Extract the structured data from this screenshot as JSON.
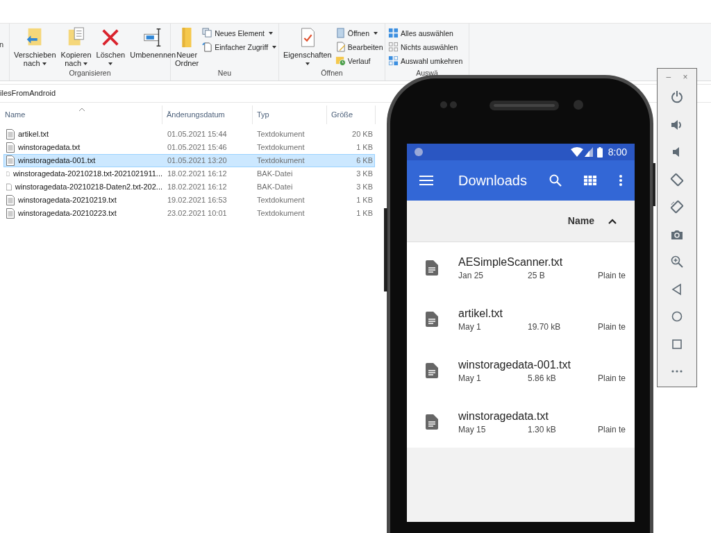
{
  "ribbon": {
    "cut_label": "n",
    "groups": [
      {
        "label": "Organisieren",
        "items": [
          {
            "kind": "large",
            "lines": [
              "Verschieben",
              "nach"
            ],
            "dropdown": true
          },
          {
            "kind": "large",
            "lines": [
              "Kopieren",
              "nach"
            ],
            "dropdown": true
          },
          {
            "kind": "large",
            "lines": [
              "Löschen"
            ],
            "dropdown": true
          },
          {
            "kind": "large",
            "lines": [
              "Umbenennen"
            ],
            "dropdown": false
          }
        ]
      },
      {
        "label": "Neu",
        "items": [
          {
            "kind": "large",
            "lines": [
              "Neuer",
              "Ordner"
            ],
            "dropdown": false
          },
          {
            "kind": "stack",
            "entries": [
              {
                "label": "Neues Element",
                "dropdown": true
              },
              {
                "label": "Einfacher Zugriff",
                "dropdown": true
              }
            ]
          }
        ]
      },
      {
        "label": "Öffnen",
        "items": [
          {
            "kind": "large",
            "lines": [
              "Eigenschaften"
            ],
            "dropdown": true
          },
          {
            "kind": "stack",
            "entries": [
              {
                "label": "Öffnen",
                "dropdown": true
              },
              {
                "label": "Bearbeiten",
                "dropdown": false
              },
              {
                "label": "Verlauf",
                "dropdown": false
              }
            ]
          }
        ]
      },
      {
        "label": "Auswä",
        "items": [
          {
            "kind": "stack",
            "entries": [
              {
                "label": "Alles auswählen",
                "dropdown": false
              },
              {
                "label": "Nichts auswählen",
                "dropdown": false
              },
              {
                "label": "Auswahl umkehren",
                "dropdown": false
              }
            ]
          }
        ]
      }
    ]
  },
  "address": "ilesFromAndroid",
  "table": {
    "columns": [
      "Name",
      "Änderungsdatum",
      "Typ",
      "Größe"
    ],
    "rows": [
      {
        "kind": "lined",
        "name": "artikel.txt",
        "date": "01.05.2021 15:44",
        "type": "Textdokument",
        "size": "20 KB",
        "selected": false
      },
      {
        "kind": "lined",
        "name": "winstoragedata.txt",
        "date": "01.05.2021 15:46",
        "type": "Textdokument",
        "size": "1 KB",
        "selected": false
      },
      {
        "kind": "lined",
        "name": "winstoragedata-001.txt",
        "date": "01.05.2021 13:20",
        "type": "Textdokument",
        "size": "6 KB",
        "selected": true
      },
      {
        "kind": "blank",
        "name": "winstoragedata-20210218.txt-2021021911...",
        "date": "18.02.2021 16:12",
        "type": "BAK-Datei",
        "size": "3 KB",
        "selected": false
      },
      {
        "kind": "blank",
        "name": "winstoragedata-20210218-Daten2.txt-202...",
        "date": "18.02.2021 16:12",
        "type": "BAK-Datei",
        "size": "3 KB",
        "selected": false
      },
      {
        "kind": "lined",
        "name": "winstoragedata-20210219.txt",
        "date": "19.02.2021 16:53",
        "type": "Textdokument",
        "size": "1 KB",
        "selected": false
      },
      {
        "kind": "lined",
        "name": "winstoragedata-20210223.txt",
        "date": "23.02.2021 10:01",
        "type": "Textdokument",
        "size": "1 KB",
        "selected": false
      }
    ]
  },
  "phone": {
    "status_bar": {
      "time": "8:00"
    },
    "app_bar": {
      "title": "Downloads"
    },
    "sort": {
      "label": "Name"
    },
    "files": [
      {
        "name": "AESimpleScanner.txt",
        "date": "Jan 25",
        "size": "25 B",
        "type": "Plain te"
      },
      {
        "name": "artikel.txt",
        "date": "May 1",
        "size": "19.70 kB",
        "type": "Plain te"
      },
      {
        "name": "winstoragedata-001.txt",
        "date": "May 1",
        "size": "5.86 kB",
        "type": "Plain te"
      },
      {
        "name": "winstoragedata.txt",
        "date": "May 15",
        "size": "1.30 kB",
        "type": "Plain te"
      }
    ]
  },
  "emulator_toolbar": {
    "minimize": "–",
    "close": "×"
  }
}
